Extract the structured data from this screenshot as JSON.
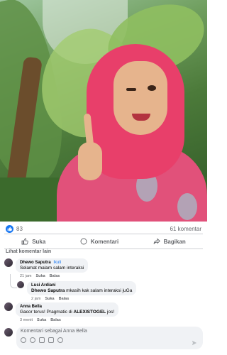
{
  "post": {
    "like_count": "83",
    "comment_count": "61 komentar"
  },
  "actions": {
    "like": "Suka",
    "comment": "Komentari",
    "share": "Bagikan"
  },
  "comments_header": "Lihat komentar lain",
  "comments": [
    {
      "name": "Dhewo Saputra",
      "follow": "Ikuti",
      "text": "Selamat malam salam interaksi",
      "time": "21 jam",
      "like": "Suka",
      "reply": "Balas"
    },
    {
      "name": "Lusi Ardiani",
      "mention": "Dhewo Saputra",
      "text": " mkasih kak salam interaksi juGa",
      "time": "2 jam",
      "like": "Suka",
      "reply": "Balas"
    },
    {
      "name": "Anna Bella",
      "text_prefix": "Gacor terus! Pragmatic di ",
      "text_bold": "ALEXISTOGEL",
      "text_suffix": " jos!",
      "time": "3 menit",
      "like": "Suka",
      "reply": "Balas"
    }
  ],
  "composer": {
    "placeholder": "Komentari sebagai Anna Bella"
  },
  "colors": {
    "accent": "#1877f2",
    "muted_text": "#65676b",
    "bubble": "#f0f2f5"
  },
  "icons": [
    "like-icon",
    "comment-icon",
    "share-icon",
    "emoji-icon",
    "camera-icon",
    "gif-icon",
    "sticker-icon",
    "send-icon"
  ]
}
